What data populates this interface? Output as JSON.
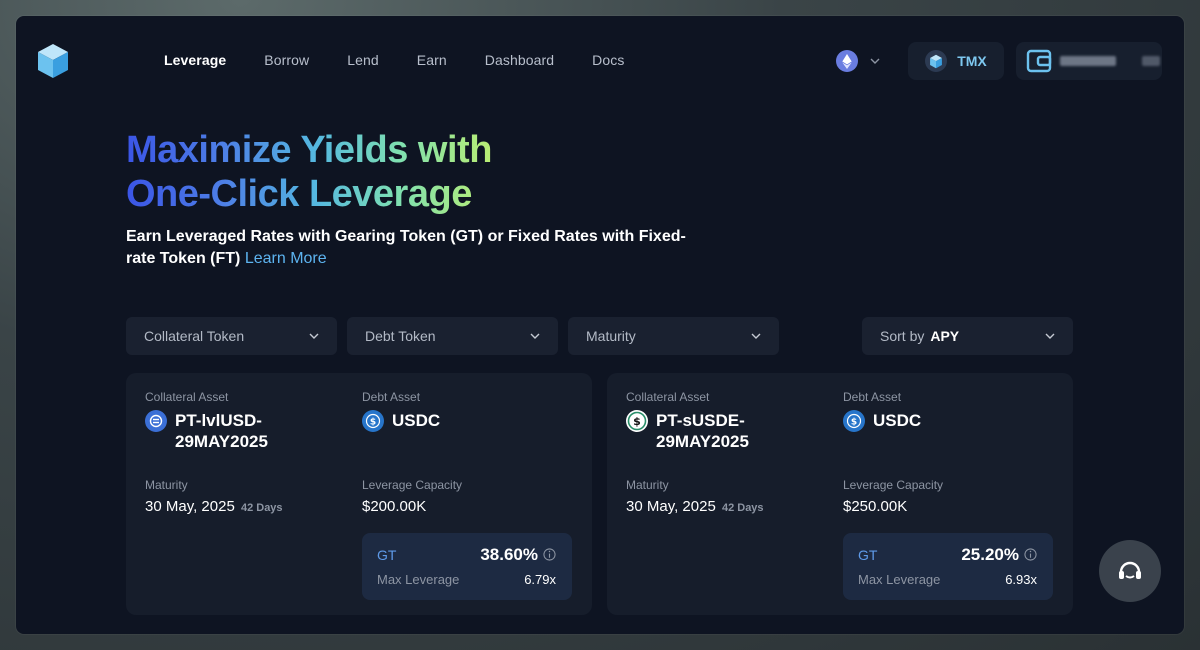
{
  "nav": {
    "items": [
      {
        "label": "Leverage",
        "active": true
      },
      {
        "label": "Borrow",
        "active": false
      },
      {
        "label": "Lend",
        "active": false
      },
      {
        "label": "Earn",
        "active": false
      },
      {
        "label": "Dashboard",
        "active": false
      },
      {
        "label": "Docs",
        "active": false
      }
    ],
    "chain_icon": "ethereum-icon",
    "tmx_label": "TMX"
  },
  "hero": {
    "title_line1": "Maximize Yields with",
    "title_line2": "One-Click Leverage",
    "subtitle": "Earn Leveraged Rates with Gearing Token (GT) or Fixed Rates with Fixed-rate Token (FT)",
    "learn_more": "Learn More"
  },
  "filters": {
    "collateral": "Collateral Token",
    "debt": "Debt Token",
    "maturity": "Maturity",
    "sort_prefix": "Sort by",
    "sort_value": "APY"
  },
  "labels": {
    "collateral_asset": "Collateral Asset",
    "debt_asset": "Debt Asset",
    "maturity": "Maturity",
    "leverage_capacity": "Leverage Capacity",
    "gt": "GT",
    "max_leverage": "Max Leverage"
  },
  "cards": [
    {
      "collateral_line1": "PT-lvlUSD-",
      "collateral_line2": "29MAY2025",
      "collateral_color": "#3b6fd6",
      "debt": "USDC",
      "maturity_date": "30 May, 2025",
      "maturity_days": "42 Days",
      "capacity": "$200.00K",
      "apy": "38.60%",
      "max_leverage": "6.79x"
    },
    {
      "collateral_line1": "PT-sUSDE-",
      "collateral_line2": "29MAY2025",
      "collateral_color": "#2a8f6a",
      "debt": "USDC",
      "maturity_date": "30 May, 2025",
      "maturity_days": "42 Days",
      "capacity": "$250.00K",
      "apy": "25.20%",
      "max_leverage": "6.93x"
    }
  ],
  "colors": {
    "accent_blue": "#5db4f0",
    "gt_blue": "#5e9ae8",
    "usdc_blue": "#2775ca"
  }
}
